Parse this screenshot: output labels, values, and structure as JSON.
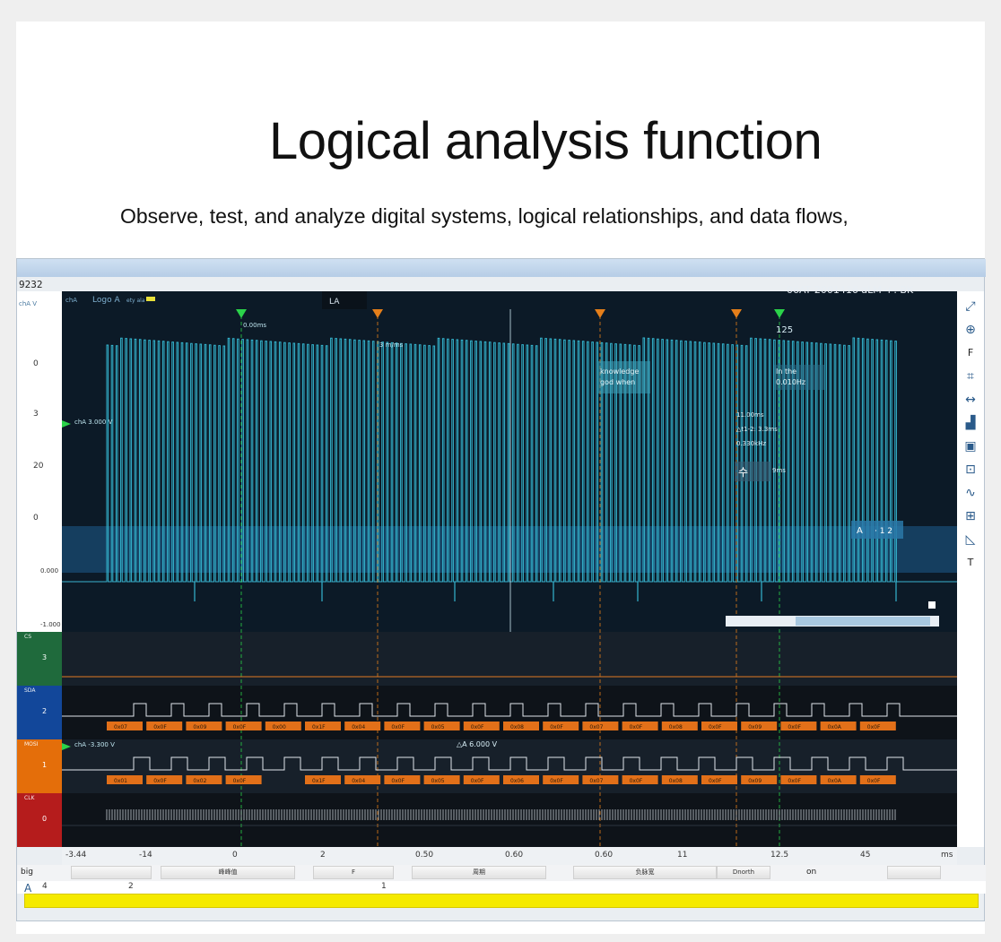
{
  "page": {
    "headline": "Logical analysis function",
    "subline": "Observe, test, and analyze digital systems, logical relationships, and data flows,"
  },
  "window": {
    "id_text": "9232",
    "info_text": "06AT 2001416 aLM ч : BK",
    "channel_label": "chA V",
    "top_tags": [
      "chA",
      "Logo A",
      "ety ala"
    ],
    "la_tab": "LA",
    "cursor_label_left": "0.00ms",
    "cursor_label_mid": "3 m/ms",
    "cursor_label_right": "125",
    "ch_offset_label": "chA 3.000 V",
    "ch_offset_label2": "chA -3.300 V",
    "delta_label": "△A 6.000 V",
    "annot_box1": [
      "knowledge",
      "god when"
    ],
    "annot_box2": [
      "In the",
      "0.010Hz"
    ],
    "meas": [
      "11.00ms",
      "△t1-2: 3.3ms",
      "0.330kHz",
      "수",
      "9ms"
    ],
    "marker_a": "A",
    "marker_a_val": "· 1 2"
  },
  "y_axis": {
    "labels": [
      "0",
      "3",
      "20",
      "0",
      "0.000",
      "-1.000"
    ]
  },
  "bands": [
    {
      "name": "CS",
      "num": "3",
      "color": "#1f6a3c"
    },
    {
      "name": "SDA",
      "num": "2",
      "color": "#12479a"
    },
    {
      "name": "MOSI",
      "num": "1",
      "color": "#e46e0a"
    },
    {
      "name": "CLK",
      "num": "0",
      "color": "#b51c1c"
    }
  ],
  "decode_row1": [
    "0x07",
    "0x0F",
    "0x09",
    "0x0F",
    "0x00",
    "0x1F",
    "0x04",
    "0x0F",
    "0x05",
    "0x0F",
    "0x08",
    "0x0F",
    "0x07",
    "0x0F",
    "0x08",
    "0x0F",
    "0x09",
    "0x0F",
    "0x0A",
    "0x0F"
  ],
  "decode_row2": [
    "0x01",
    "0x0F",
    "0x02",
    "0x0F",
    "",
    "0x1F",
    "0x04",
    "0x0F",
    "0x05",
    "0x0F",
    "0x06",
    "0x0F",
    "0x07",
    "0x0F",
    "0x08",
    "0x0F",
    "0x09",
    "0x0F",
    "0x0A",
    "0x0F"
  ],
  "x_axis": {
    "labels": [
      "-3.44",
      "-14",
      "0",
      "2",
      "0.50",
      "0.60",
      "0.60",
      "11",
      "12.5",
      "45",
      "ms"
    ]
  },
  "status": {
    "big": "big",
    "btn1": "峰峰值",
    "f": "F",
    "btn2": "周期",
    "btn3": "负脉宽",
    "btn4": "Dnorth",
    "on": "on"
  },
  "row2": {
    "a_label": "A",
    "a_val": "4",
    "v2": "2",
    "v3": "1"
  },
  "tools": [
    "expand-icon",
    "zoom-icon",
    "F",
    "crop-icon",
    "fit-width-icon",
    "histogram-icon",
    "save-icon",
    "screenshot-icon",
    "wave-icon",
    "grid-icon",
    "measure-icon",
    "T"
  ],
  "colors": {
    "plot_bg": "#0c1a27",
    "trace": "#34b6d0",
    "decode": "#e27019",
    "cursor_green": "#2bd34a",
    "cursor_orange": "#e57f1a",
    "highlight": "#f5ea00"
  }
}
